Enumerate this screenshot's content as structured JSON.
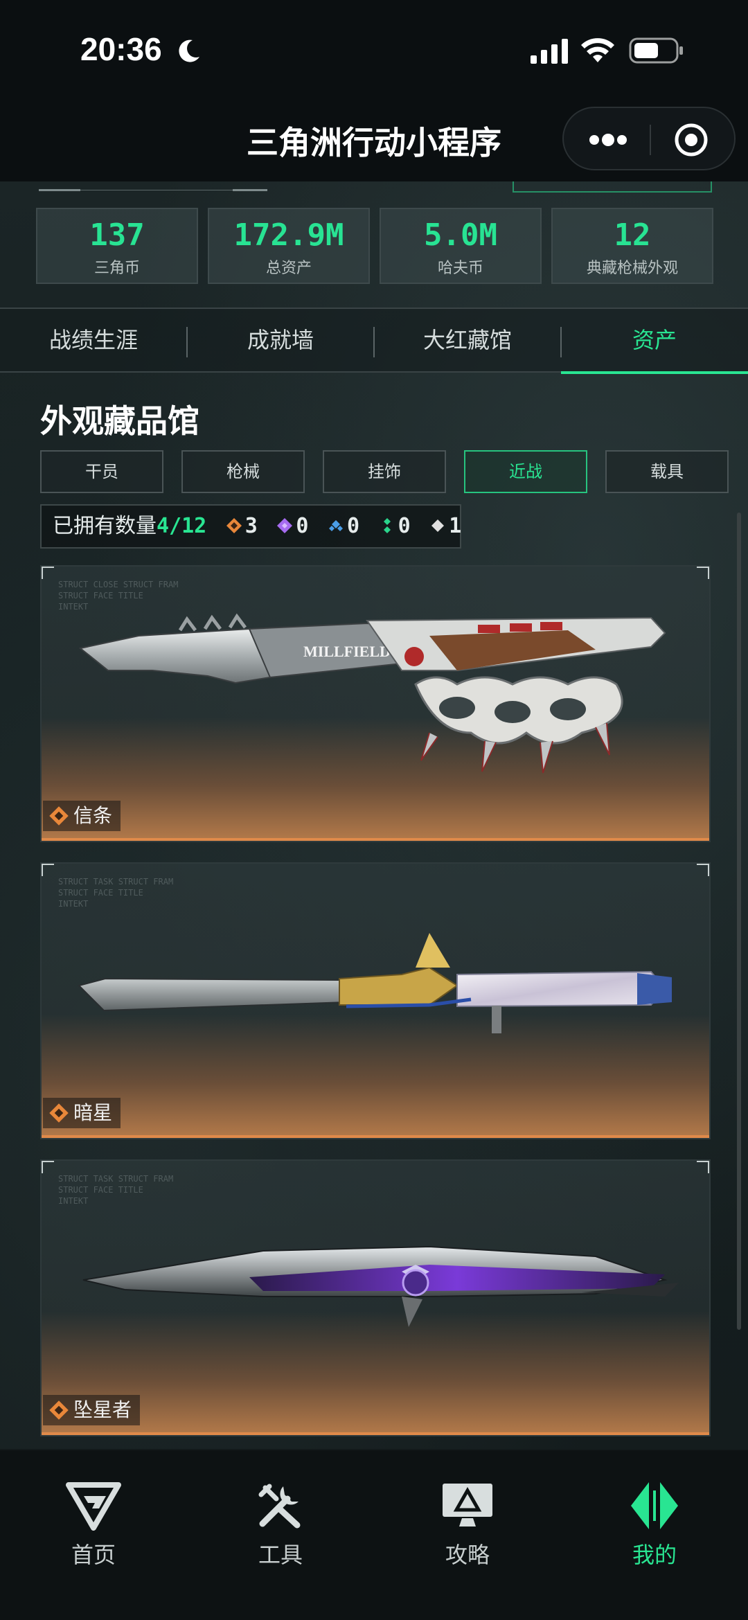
{
  "status": {
    "time": "20:36"
  },
  "nav": {
    "title": "三角洲行动小程序"
  },
  "stats": [
    {
      "value": "137",
      "label": "三角币"
    },
    {
      "value": "172.9M",
      "label": "总资产"
    },
    {
      "value": "5.0M",
      "label": "哈夫币"
    },
    {
      "value": "12",
      "label": "典藏枪械外观"
    }
  ],
  "tabs": [
    {
      "label": "战绩生涯"
    },
    {
      "label": "成就墙"
    },
    {
      "label": "大红藏馆"
    },
    {
      "label": "资产",
      "active": true
    }
  ],
  "section": {
    "title": "外观藏品馆"
  },
  "filters": [
    {
      "label": "干员"
    },
    {
      "label": "枪械"
    },
    {
      "label": "挂饰"
    },
    {
      "label": "近战",
      "active": true
    },
    {
      "label": "载具"
    }
  ],
  "owned": {
    "prefix": "已拥有数量",
    "count": "4/12",
    "rarities": [
      {
        "icon": "orange-diamond-icon",
        "value": "3",
        "color": "#e8873a"
      },
      {
        "icon": "purple-diamond-icon",
        "value": "0",
        "color": "#a66cf0"
      },
      {
        "icon": "blue-diamond-icon",
        "value": "0",
        "color": "#4a9ee8"
      },
      {
        "icon": "green-diamond-icon",
        "value": "0",
        "color": "#2ad48b"
      },
      {
        "icon": "white-diamond-icon",
        "value": "1",
        "color": "#e0e0e0"
      }
    ]
  },
  "items": [
    {
      "name": "信条",
      "faint": "STRUCT CLOSE STRUCT FRAM\nSTRUCT FACE TITLE\nINTEKT"
    },
    {
      "name": "暗星",
      "faint": "STRUCT TASK STRUCT FRAM\nSTRUCT FACE TITLE\nINTEKT"
    },
    {
      "name": "坠星者",
      "faint": "STRUCT TASK STRUCT FRAM\nSTRUCT FACE TITLE\nINTEKT"
    }
  ],
  "bottom_tabs": [
    {
      "label": "首页",
      "icon": "delta-logo-icon"
    },
    {
      "label": "工具",
      "icon": "tools-icon"
    },
    {
      "label": "攻略",
      "icon": "monitor-icon"
    },
    {
      "label": "我的",
      "icon": "profile-emblem-icon",
      "active": true
    }
  ],
  "colors": {
    "accent": "#29e592",
    "rarity_orange": "#e8873a"
  }
}
